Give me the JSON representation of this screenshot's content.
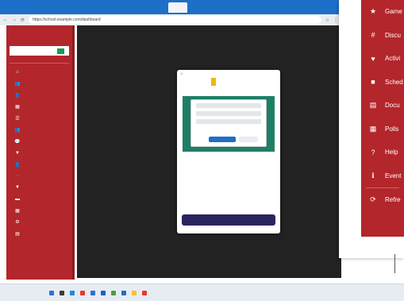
{
  "browser": {
    "address": "https://school.example.com/dashboard"
  },
  "sidebar": {
    "items": [
      {
        "icon": "home-icon",
        "glyph": "⌂"
      },
      {
        "icon": "users-icon",
        "glyph": "👥"
      },
      {
        "icon": "person-icon",
        "glyph": "👤"
      },
      {
        "icon": "grid-icon",
        "glyph": "▦"
      },
      {
        "icon": "list-icon",
        "glyph": "☰"
      },
      {
        "icon": "group-icon",
        "glyph": "👥"
      },
      {
        "icon": "chat-icon",
        "glyph": "💬"
      },
      {
        "icon": "filter-icon",
        "glyph": "▼"
      },
      {
        "icon": "user-icon",
        "glyph": "👤"
      },
      {
        "icon": "blank-icon",
        "glyph": "·"
      },
      {
        "icon": "filter-icon",
        "glyph": "▼"
      },
      {
        "icon": "folder-icon",
        "glyph": "▬"
      },
      {
        "icon": "calculator-icon",
        "glyph": "▦"
      },
      {
        "icon": "settings-icon",
        "glyph": "⚙"
      },
      {
        "icon": "doc-icon",
        "glyph": "▤"
      }
    ]
  },
  "modal": {
    "close": "×"
  },
  "dropdown": {
    "items": [
      {
        "label": "Game",
        "icon": "star-icon",
        "glyph": "★"
      },
      {
        "label": "Discu",
        "icon": "hashtag-icon",
        "glyph": "#"
      },
      {
        "label": "Activi",
        "icon": "heart-icon",
        "glyph": "♥"
      },
      {
        "label": "Sched",
        "icon": "folder-icon",
        "glyph": "■"
      },
      {
        "label": "Docu",
        "icon": "document-icon",
        "glyph": "▤"
      },
      {
        "label": "Polls",
        "icon": "poll-icon",
        "glyph": "▦"
      },
      {
        "label": "Help",
        "icon": "help-icon",
        "glyph": "?"
      },
      {
        "label": "Event",
        "icon": "info-icon",
        "glyph": "ℹ"
      },
      {
        "label": "Refre",
        "icon": "refresh-icon",
        "glyph": "⟳"
      }
    ]
  },
  "colors": {
    "brand_red": "#b3262b",
    "modal_button": "#2a2460",
    "preview_green": "#1e7e66",
    "browser_blue": "#1e6fc8"
  }
}
